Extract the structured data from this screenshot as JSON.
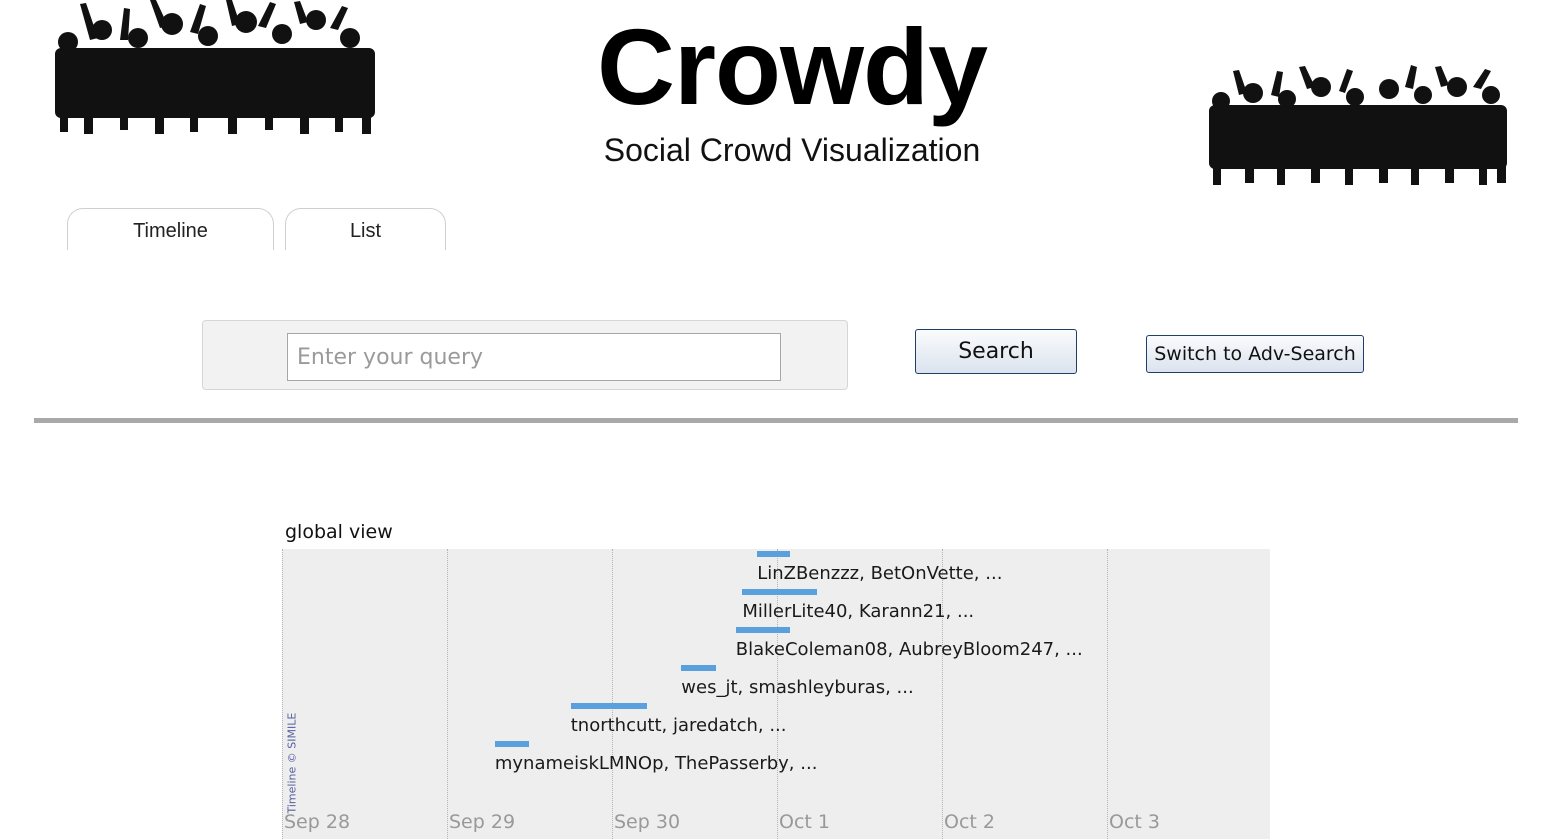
{
  "header": {
    "title": "Crowdy",
    "subtitle": "Social Crowd Visualization",
    "left_image": "crowd-silhouette-icon",
    "right_image": "crowd-silhouette-icon"
  },
  "tabs": [
    {
      "label": "Timeline"
    },
    {
      "label": "List"
    }
  ],
  "search": {
    "placeholder": "Enter your query",
    "value": "",
    "button_label": "Search",
    "adv_button_label": "Switch to Adv-Search"
  },
  "timeline": {
    "title": "global view",
    "credit": "Timeline © SIMILE",
    "dates": [
      "Sep 28",
      "Sep 29",
      "Sep 30",
      "Oct 1",
      "Oct 2",
      "Oct 3"
    ],
    "events": [
      {
        "label": "LinZBenzzz, BetOnVette, ...",
        "start_day": 2.88,
        "end_day": 3.08
      },
      {
        "label": "MillerLite40, Karann21, ...",
        "start_day": 2.79,
        "end_day": 3.24
      },
      {
        "label": "BlakeColeman08, AubreyBloom247, ...",
        "start_day": 2.75,
        "end_day": 3.08
      },
      {
        "label": "wes_jt, smashleyburas, ...",
        "start_day": 2.42,
        "end_day": 2.63
      },
      {
        "label": "tnorthcutt, jaredatch, ...",
        "start_day": 1.75,
        "end_day": 2.21
      },
      {
        "label": "mynameiskLMNOp, ThePasserby, ...",
        "start_day": 1.29,
        "end_day": 1.5
      }
    ],
    "colors": {
      "bar": "#5aa0dc",
      "band": "#eeeeee"
    }
  }
}
